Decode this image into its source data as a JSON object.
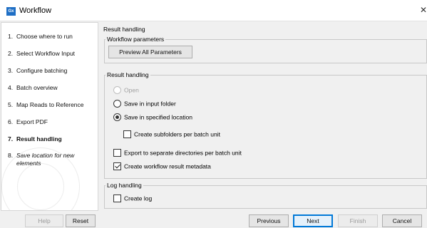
{
  "window": {
    "app_icon": "Gx",
    "title": "Workflow",
    "close": "✕"
  },
  "sidebar": {
    "steps": [
      {
        "num": "1.",
        "label": "Choose where to run"
      },
      {
        "num": "2.",
        "label": "Select Workflow Input"
      },
      {
        "num": "3.",
        "label": "Configure batching"
      },
      {
        "num": "4.",
        "label": "Batch overview"
      },
      {
        "num": "5.",
        "label": "Map Reads to Reference"
      },
      {
        "num": "6.",
        "label": "Export PDF"
      },
      {
        "num": "7.",
        "label": "Result handling"
      },
      {
        "num": "8.",
        "label": "Save location for new elements"
      }
    ]
  },
  "main": {
    "section_title": "Result handling",
    "workflow_params": {
      "legend": "Workflow parameters",
      "preview_button": "Preview All Parameters"
    },
    "result_handling": {
      "legend": "Result handling",
      "open": "Open",
      "save_input": "Save in input folder",
      "save_specified": "Save in specified location",
      "create_subfolders": "Create subfolders per batch unit",
      "export_separate": "Export to separate directories per batch unit",
      "create_metadata": "Create workflow result metadata"
    },
    "log_handling": {
      "legend": "Log handling",
      "create_log": "Create log"
    }
  },
  "footer": {
    "help": "Help",
    "reset": "Reset",
    "previous": "Previous",
    "next": "Next",
    "finish": "Finish",
    "cancel": "Cancel"
  }
}
